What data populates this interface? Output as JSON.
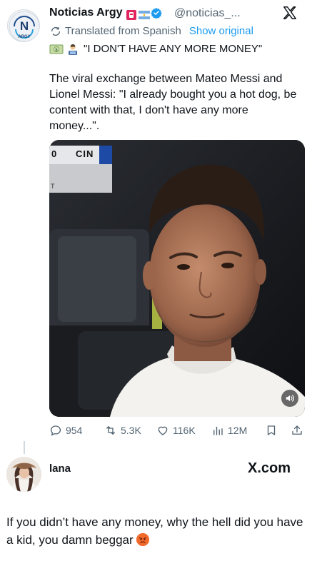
{
  "colors": {
    "text": "#0f1419",
    "muted": "#536471",
    "link": "#1d9bf0",
    "verified": "#1d9bf0"
  },
  "account": {
    "display_name": "Noticias Argy",
    "handle": "@noticias_...",
    "avatar_text": "N",
    "avatar_caption": "ARGY",
    "badges": [
      "red-square-badge",
      "argentina-flag-badge",
      "verified-badge"
    ]
  },
  "translation": {
    "label": "Translated from Spanish",
    "show_original": "Show original"
  },
  "headline": {
    "emojis": [
      "dollar-banknote-emoji",
      "technologist-emoji"
    ],
    "text": "\"I DON'T HAVE ANY MORE MONEY\""
  },
  "body": "The viral exchange between Mateo Messi and Lionel Messi: \"I already bought you a hot dog, be content with that, I don't have any more money...\".",
  "media": {
    "scorebug_score": "0",
    "scorebug_team": "CIN",
    "scorebug_lower": "T",
    "mute_icon": "speaker-icon"
  },
  "actions": {
    "replies": "954",
    "reposts": "5.3K",
    "likes": "116K",
    "views": "12M"
  },
  "reply": {
    "name": "lana",
    "site": "X.com",
    "text": "If you didn’t have any money, why the hell did you have a kid, you damn beggar",
    "emoji": "angry-face-emoji"
  }
}
